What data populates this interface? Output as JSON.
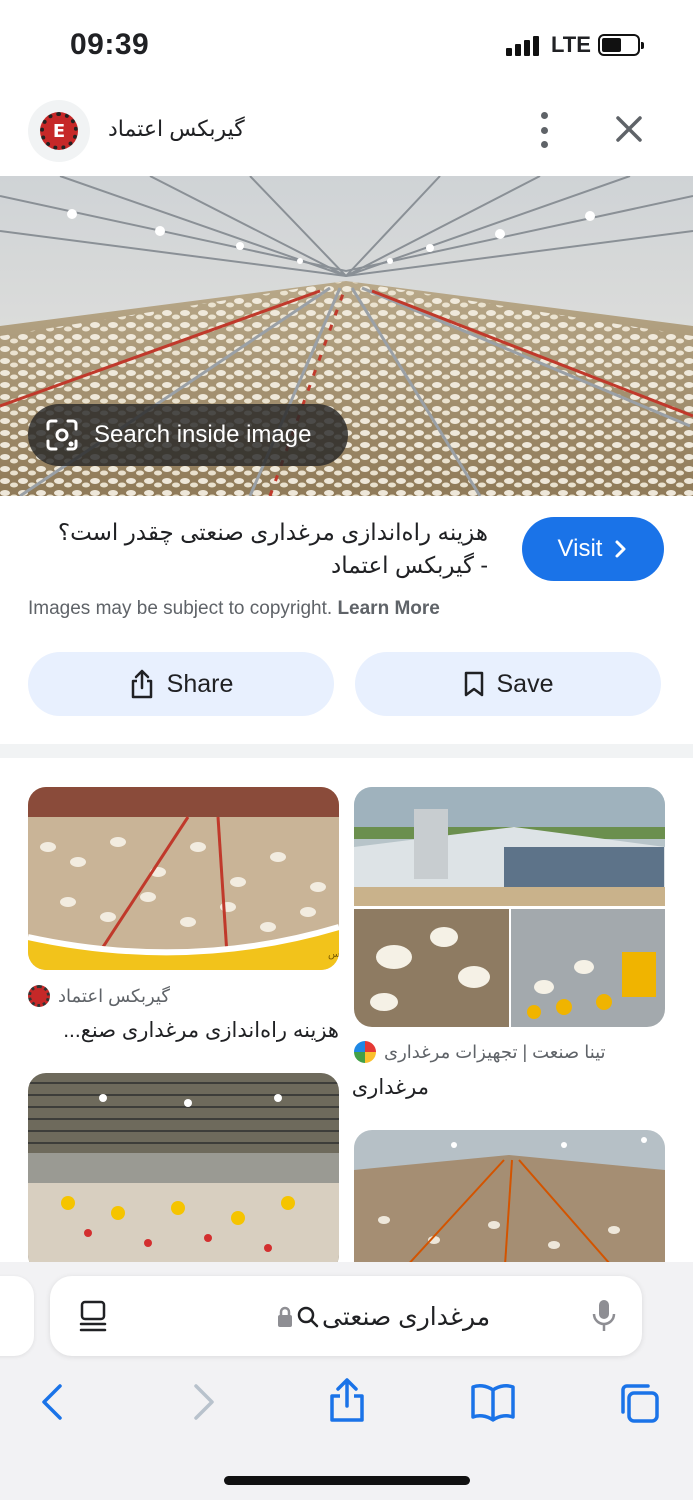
{
  "status_bar": {
    "time": "09:39",
    "network": "LTE",
    "battery_level": 0.55
  },
  "header": {
    "site_name": "گیربکس اعتماد",
    "logo_letter": "E",
    "menu_icon": "more-vert-icon",
    "close_icon": "close-icon"
  },
  "hero": {
    "lens_label": "Search inside image",
    "lens_icon": "lens-icon"
  },
  "result": {
    "title_line1": "هزینه راه‌اندازی مرغداری صنعتی چقدر است؟",
    "title_line2": "- گیربکس اعتماد",
    "visit_label": "Visit",
    "copyright_text": "Images may be subject to copyright.",
    "learn_more": "Learn More"
  },
  "actions": {
    "share_label": "Share",
    "save_label": "Save"
  },
  "related": [
    {
      "source": "گیربکس اعتماد",
      "title": "هزینه راه‌اندازی مرغداری صنع...",
      "overlay_text": "مرجع مقالات گیربوکس"
    },
    {
      "source": "تینا صنعت | تجهیزات مرغداری",
      "title": "مرغداری"
    },
    {
      "source": "",
      "title": ""
    },
    {
      "source": "",
      "title": ""
    }
  ],
  "browser": {
    "url_query": "مرغداری صنعتی",
    "reader_icon": "reader-mode-icon",
    "lock_icon": "lock-icon",
    "search_icon": "search-icon",
    "mic_icon": "mic-icon"
  },
  "colors": {
    "accent": "#1a73e8",
    "chip_bg": "#e8f0fe",
    "brand_red": "#c62828"
  }
}
